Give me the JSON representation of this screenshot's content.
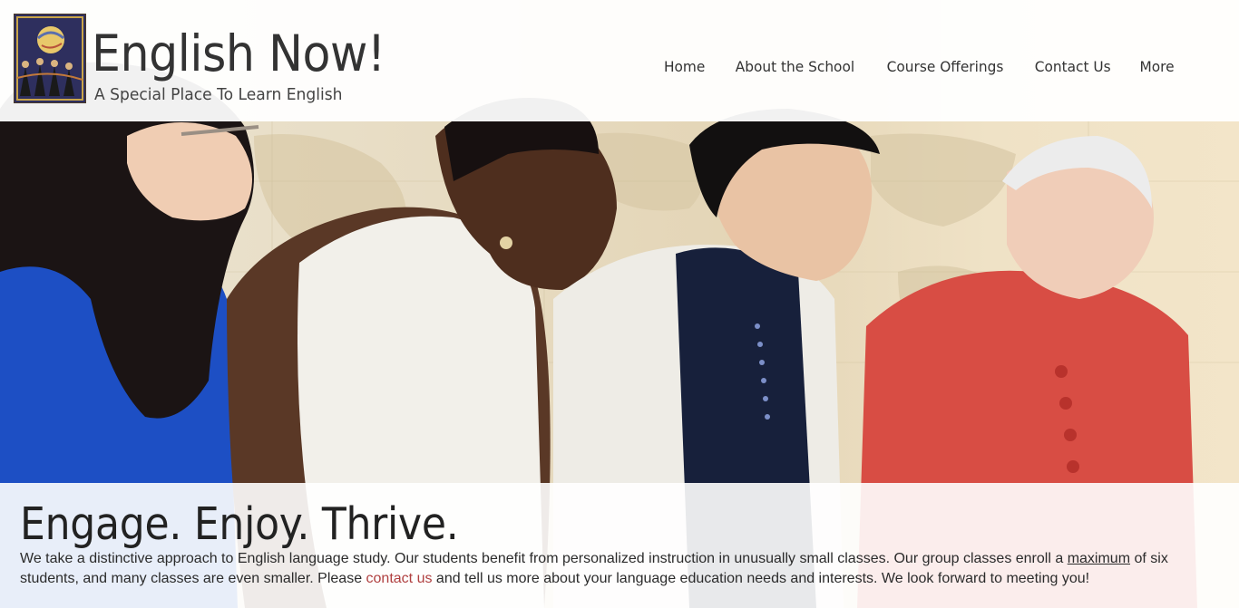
{
  "header": {
    "site_title": "English Now!",
    "tagline": "A Special Place To Learn English",
    "logo_icon": "school-logo-illustration"
  },
  "nav": {
    "items": [
      {
        "label": "Home"
      },
      {
        "label": "About the School"
      },
      {
        "label": "Course Offerings"
      },
      {
        "label": "Contact Us"
      },
      {
        "label": "More"
      }
    ]
  },
  "hero": {
    "image": "photo-of-four-women-laughing-in-front-of-world-map"
  },
  "content": {
    "headline": "Engage. Enjoy. Thrive.",
    "intro_part1": "We take a distinctive approach to English language study. Our students benefit from personalized instruction in unusually small classes. Our group classes enroll a ",
    "intro_link_maximum": "maximum",
    "intro_part2": " of six students, and many classes are even smaller. Please ",
    "intro_link_contact": "contact us",
    "intro_part3": " and tell us more about your language education needs and interests. We look forward to meeting you!"
  },
  "colors": {
    "link_accent": "#b04040",
    "text": "#333333",
    "header_bg": "#ffffff"
  }
}
